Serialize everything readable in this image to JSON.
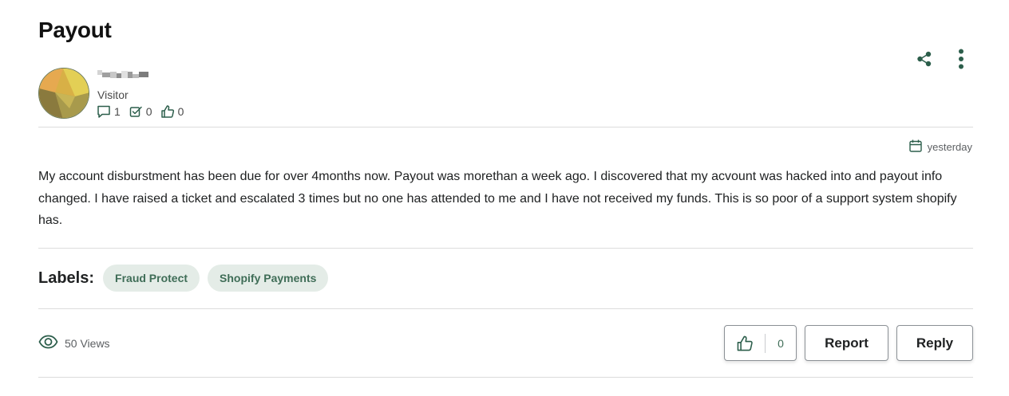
{
  "post": {
    "title": "Payout",
    "author": {
      "role": "Visitor",
      "stats": {
        "messages": "1",
        "solutions": "0",
        "likes": "0"
      }
    },
    "date": "yesterday",
    "body": "My account disburstment has been due for over 4months now. Payout was morethan a week ago. I discovered that my acvount was hacked into and payout info changed.  I have raised a ticket and escalated 3 times but no one has attended to me and I have not received my funds. This is so poor of a support system shopify has.",
    "labels_title": "Labels:",
    "labels": [
      "Fraud Protect",
      "Shopify Payments"
    ],
    "views": "50 Views",
    "like_count": "0",
    "report_label": "Report",
    "reply_label": "Reply"
  },
  "icons": {
    "share": "share-icon",
    "more": "more-vertical-icon",
    "calendar": "calendar-icon",
    "eye": "eye-icon",
    "thumbs_up": "thumbs-up-icon",
    "message": "message-icon",
    "check": "checkbox-icon"
  },
  "colors": {
    "accent": "#3f6d57",
    "tag_bg": "#e4ece7",
    "icon": "#2c5e4b"
  }
}
